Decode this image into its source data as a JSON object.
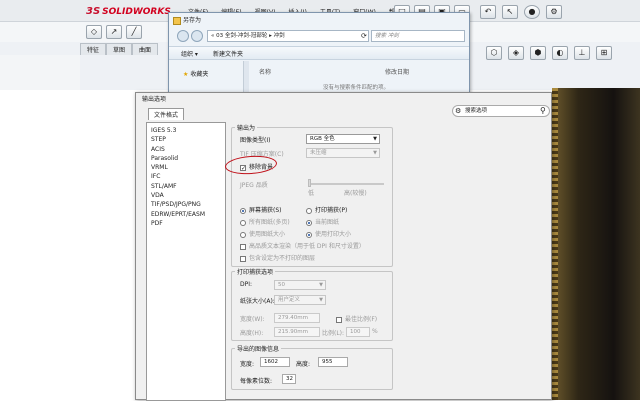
{
  "solidworks": {
    "logo_prefix": "3S",
    "logo": "SOLIDWORKS",
    "menu": [
      "文件(F)",
      "编辑(E)",
      "视图(V)",
      "插入(I)",
      "工具(T)",
      "窗口(W)",
      "帮助"
    ],
    "tabs": [
      "特征",
      "草图",
      "曲面"
    ]
  },
  "save_as": {
    "title": "另存为",
    "path": "« 03 全剑-冲剑-冠部轮 ▸ 冲剑",
    "search_placeholder": "搜索 冲剑",
    "organize": "组织 ▾",
    "new_folder": "新建文件夹",
    "favorites": "收藏夹",
    "col_name": "名称",
    "col_date": "修改日期",
    "empty_message": "没有与搜索条件匹配的项。"
  },
  "export": {
    "title": "输出选项",
    "tab": "文件格式",
    "search_placeholder": "搜索选项",
    "formats": [
      "IGES 5.3",
      "STEP",
      "ACIS",
      "Parasolid",
      "VRML",
      "IFC",
      "STL/AMF",
      "VDA",
      "TIF/PSD/JPG/PNG",
      "EDRW/EPRT/EASM",
      "PDF"
    ],
    "output_as": "输出为",
    "image_type_label": "图像类型(I)",
    "image_type_value": "RGB 全色",
    "tiff_compress_label": "TIF 压缩方案(C)",
    "tiff_compress_value": "未压缩",
    "remove_bg": "移除背景",
    "jpeg_label": "JPEG 品质",
    "slider_low": "低",
    "slider_high": "高(较慢)",
    "radio_screen": "屏幕捕获(S)",
    "radio_print": "打印捕获(P)",
    "radio_all_views": "所有图纸(多页)",
    "radio_current": "当前图纸",
    "radio_sheet_size": "使用图纸大小",
    "radio_print_size": "使用打印大小",
    "chk_hq": "高品质文本渲染（用于低 DPI 和尺寸设置）",
    "chk_hide": "包含设定为不打印的图层",
    "print_group": "打印捕获选项",
    "dpi_label": "DPI:",
    "dpi_value": "50",
    "paper_label": "纸张大小(A):",
    "paper_value": "用户定义",
    "width_label": "宽度(W):",
    "width_value": "279.40mm",
    "height_label": "高度(H):",
    "height_value": "215.90mm",
    "scale_fit": "最佳比例(F)",
    "scale_label": "比例(L):",
    "scale_value": "100",
    "scale_unit": "%",
    "info_group": "导出的图像信息",
    "info_width_label": "宽度:",
    "info_width_value": "1602",
    "info_height_label": "高度:",
    "info_height_value": "955",
    "bits_label": "每像素位数:",
    "bits_value": "32"
  }
}
